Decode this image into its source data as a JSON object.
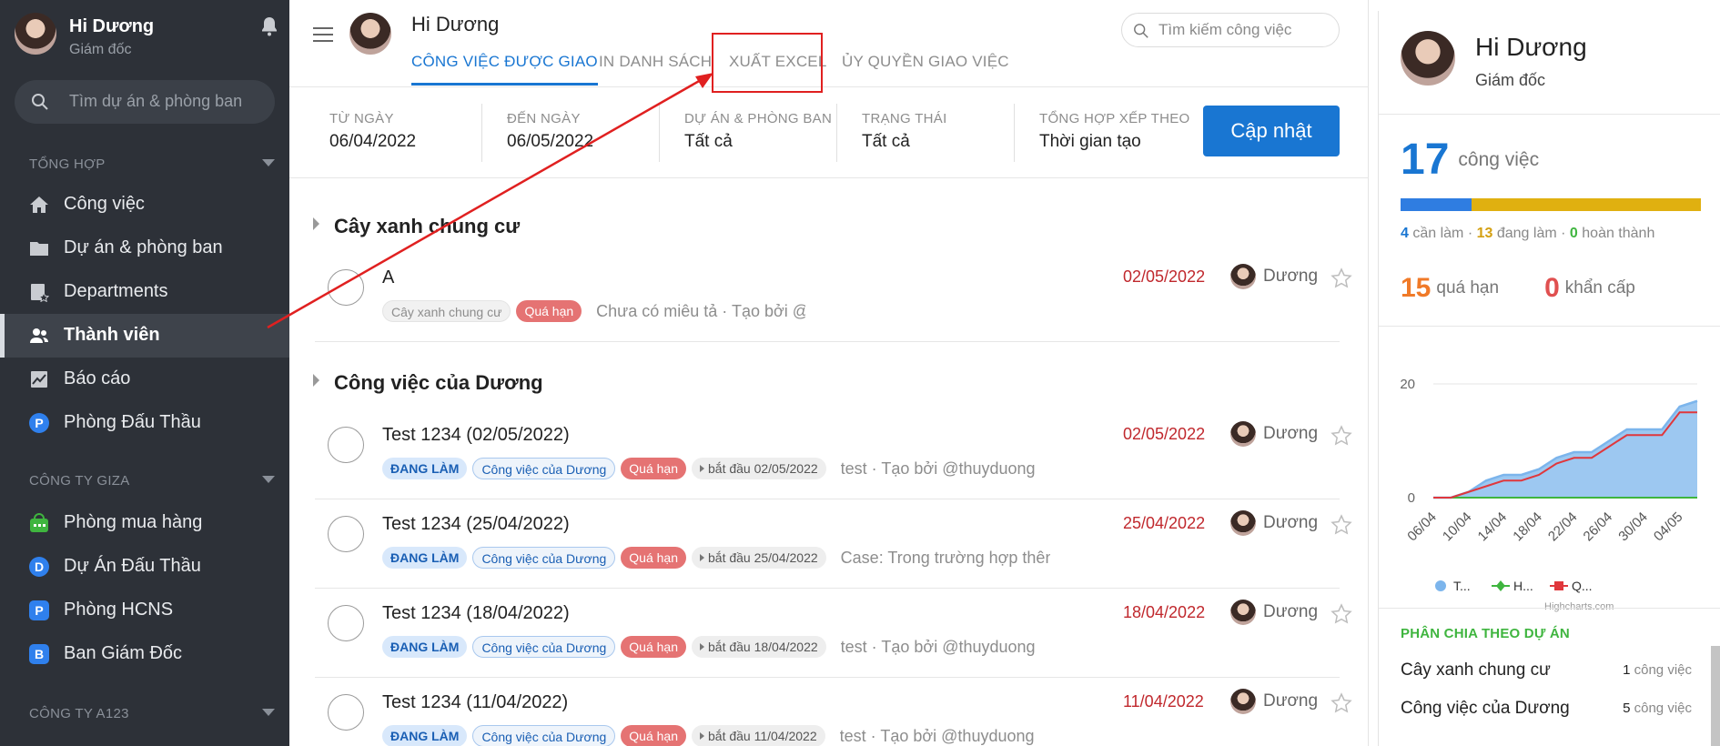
{
  "sidebar": {
    "user": {
      "name": "Hi Dương",
      "role": "Giám đốc"
    },
    "search_placeholder": "Tìm dự án & phòng ban",
    "sections": [
      {
        "label": "TỔNG HỢP"
      },
      {
        "label": "CÔNG TY GIZA"
      },
      {
        "label": "CÔNG TY A123"
      }
    ],
    "items": [
      {
        "label": "Công việc",
        "icon": "home-icon"
      },
      {
        "label": "Dự án & phòng ban",
        "icon": "folder-icon"
      },
      {
        "label": "Departments",
        "icon": "star-list-icon"
      },
      {
        "label": "Thành viên",
        "icon": "members-icon"
      },
      {
        "label": "Báo cáo",
        "icon": "chart-icon"
      },
      {
        "label": "Phòng Đấu Thầu",
        "icon": "P"
      },
      {
        "label": "Phòng mua hàng",
        "icon": "store-icon"
      },
      {
        "label": "Dự Án Đấu Thầu",
        "icon": "D"
      },
      {
        "label": "Phòng HCNS",
        "icon": "P"
      },
      {
        "label": "Ban Giám Đốc",
        "icon": "B"
      }
    ]
  },
  "header": {
    "name": "Hi Dương",
    "tabs": [
      {
        "label": "CÔNG VIỆC ĐƯỢC GIAO"
      },
      {
        "label": "IN DANH SÁCH"
      },
      {
        "label": "XUẤT EXCEL"
      },
      {
        "label": "ỦY QUYỀN GIAO VIỆC"
      }
    ],
    "search_placeholder": "Tìm kiếm công việc"
  },
  "filters": [
    {
      "label": "TỪ NGÀY",
      "value": "06/04/2022"
    },
    {
      "label": "ĐẾN NGÀY",
      "value": "06/05/2022"
    },
    {
      "label": "DỰ ÁN & PHÒNG BAN",
      "value": "Tất cả"
    },
    {
      "label": "TRẠNG THÁI",
      "value": "Tất cả"
    },
    {
      "label": "TỔNG HỢP XẾP THEO",
      "value": "Thời gian tạo"
    }
  ],
  "update_button": "Cập nhật",
  "groups": [
    {
      "title": "Cây xanh chung cư"
    },
    {
      "title": "Công việc của Dương"
    }
  ],
  "tasks": [
    {
      "title": "A",
      "status": "",
      "project": "Cây xanh chung cư",
      "overdue": "Quá hạn",
      "start": "",
      "desc": "Chưa có miêu tả · Tạo bởi @thuyduong",
      "due": "02/05/2022",
      "assignee": "Dương"
    },
    {
      "title": "Test 1234 (02/05/2022)",
      "status": "ĐANG LÀM",
      "project": "Công việc của Dương",
      "overdue": "Quá hạn",
      "start": "bắt đầu 02/05/2022",
      "desc": "test · Tạo bởi @thuyduong",
      "due": "02/05/2022",
      "assignee": "Dương"
    },
    {
      "title": "Test 1234 (25/04/2022)",
      "status": "ĐANG LÀM",
      "project": "Công việc của Dương",
      "overdue": "Quá hạn",
      "start": "bắt đầu 25/04/2022",
      "desc": "Case:  Trong trường hợp thên",
      "due": "25/04/2022",
      "assignee": "Dương"
    },
    {
      "title": "Test 1234 (18/04/2022)",
      "status": "ĐANG LÀM",
      "project": "Công việc của Dương",
      "overdue": "Quá hạn",
      "start": "bắt đầu 18/04/2022",
      "desc": "test · Tạo bởi @thuyduong",
      "due": "18/04/2022",
      "assignee": "Dương"
    },
    {
      "title": "Test 1234 (11/04/2022)",
      "status": "ĐANG LÀM",
      "project": "Công việc của Dương",
      "overdue": "Quá hạn",
      "start": "bắt đầu 11/04/2022",
      "desc": "test · Tạo bởi @thuyduong",
      "due": "11/04/2022",
      "assignee": "Dương"
    }
  ],
  "right_panel": {
    "name": "Hi Dương",
    "role": "Giám đốc",
    "total": "17",
    "total_unit": "công việc",
    "todo": "4",
    "todo_label": "cần làm",
    "doing": "13",
    "doing_label": "đang làm",
    "done": "0",
    "done_label": "hoàn thành",
    "overdue": "15",
    "overdue_label": "quá hạn",
    "urgent": "0",
    "urgent_label": "khẩn cấp",
    "projects_title": "PHÂN CHIA THEO DỰ ÁN",
    "projects": [
      {
        "name": "Cây xanh chung cư",
        "count": "1",
        "unit": "công việc"
      },
      {
        "name": "Công việc của Dương",
        "count": "5",
        "unit": "công việc"
      }
    ],
    "credits": "Highcharts.com"
  },
  "chart_data": {
    "type": "area",
    "x": [
      "06/04",
      "08/04",
      "10/04",
      "12/04",
      "14/04",
      "16/04",
      "18/04",
      "20/04",
      "22/04",
      "24/04",
      "26/04",
      "28/04",
      "30/04",
      "02/05",
      "04/05",
      "06/05"
    ],
    "tick_labels": [
      "06/04",
      "10/04",
      "14/04",
      "18/04",
      "22/04",
      "26/04",
      "30/04",
      "04/05"
    ],
    "ylim": [
      0,
      20
    ],
    "y_ticks": [
      "20",
      "0"
    ],
    "series": [
      {
        "name": "T...",
        "type": "area",
        "color": "#7cb5ec",
        "values": [
          0,
          0,
          1,
          3,
          4,
          4,
          5,
          7,
          8,
          8,
          10,
          12,
          12,
          12,
          16,
          17
        ]
      },
      {
        "name": "H...",
        "type": "line",
        "color": "#3fb53f",
        "values": [
          0,
          0,
          0,
          0,
          0,
          0,
          0,
          0,
          0,
          0,
          0,
          0,
          0,
          0,
          0,
          0
        ]
      },
      {
        "name": "Q...",
        "type": "line",
        "color": "#e0373c",
        "values": [
          0,
          0,
          1,
          2,
          3,
          3,
          4,
          6,
          7,
          7,
          9,
          11,
          11,
          11,
          15,
          15
        ]
      }
    ]
  }
}
